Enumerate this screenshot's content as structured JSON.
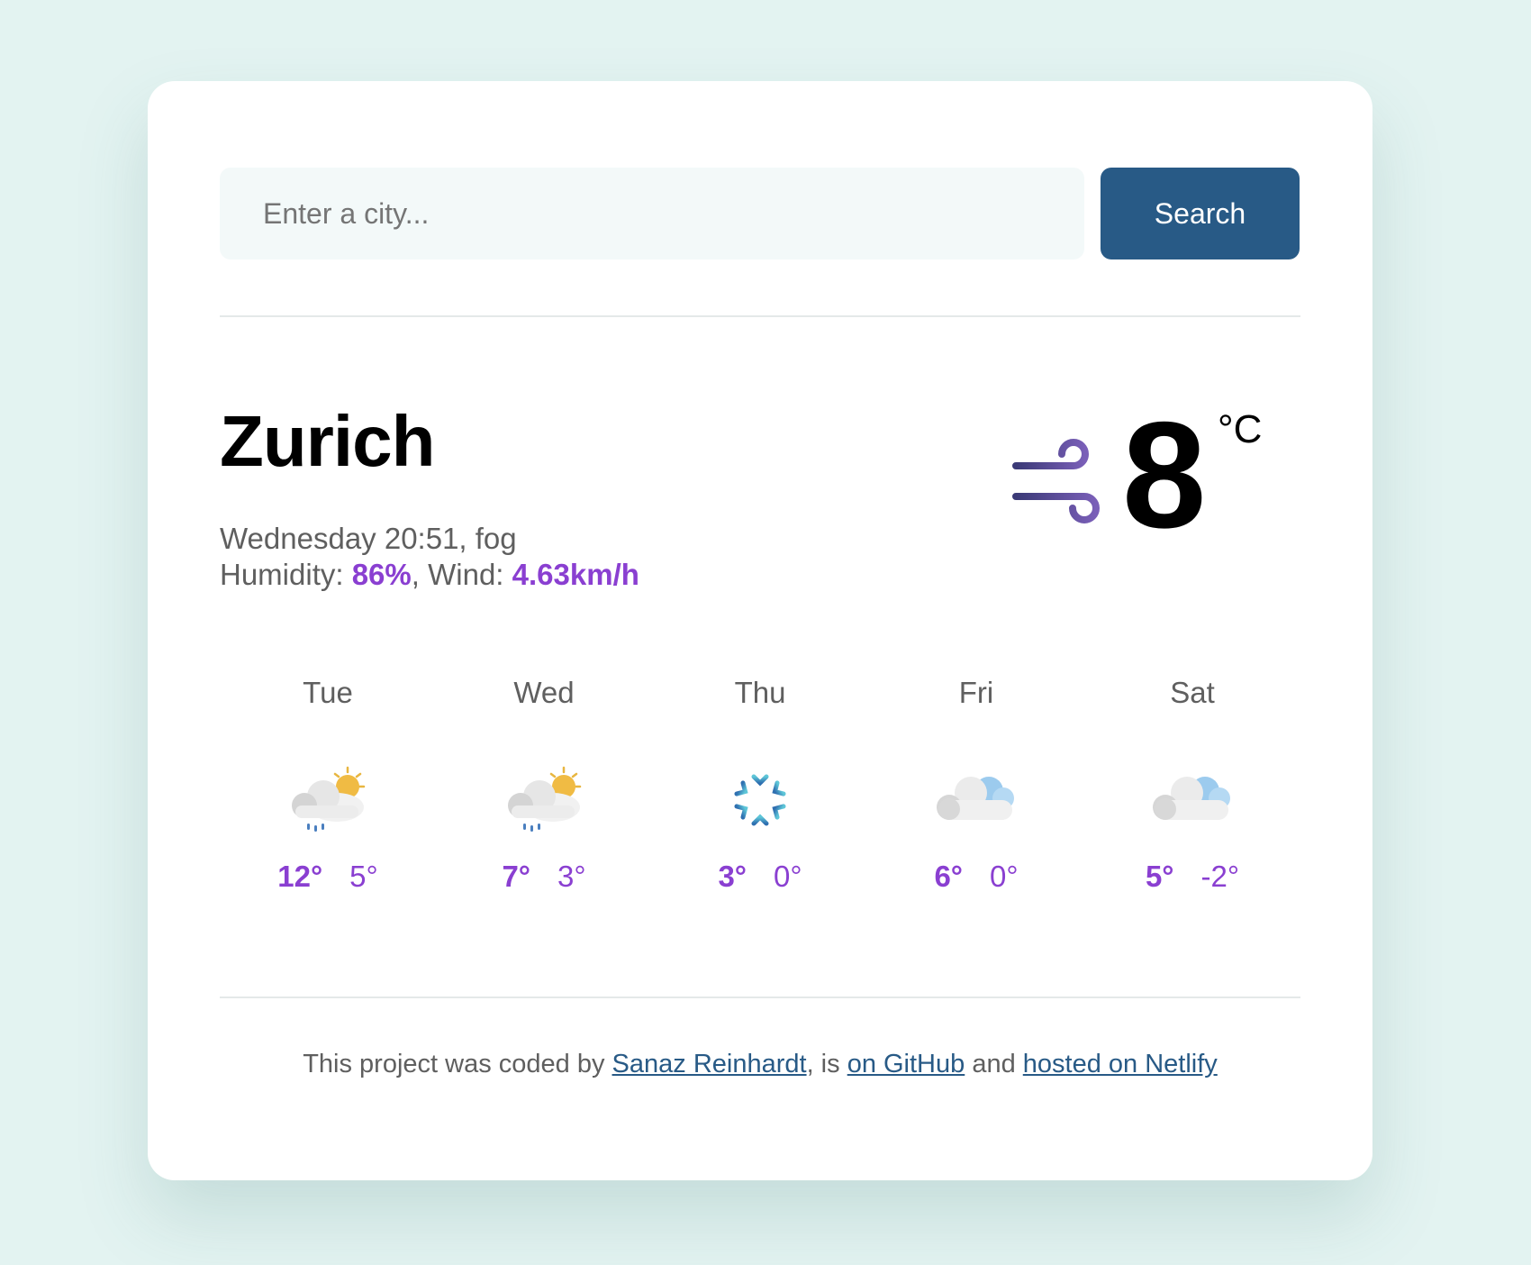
{
  "search": {
    "placeholder": "Enter a city...",
    "value": "",
    "button_label": "Search"
  },
  "current": {
    "city": "Zurich",
    "day_time": "Wednesday 20:51",
    "description": "fog",
    "humidity_label": "Humidity:",
    "humidity_value": "86%",
    "wind_label": "Wind:",
    "wind_value": "4.63km/h",
    "temperature": "8",
    "unit": "°C",
    "icon": "wind-icon"
  },
  "forecast": [
    {
      "day": "Tue",
      "icon": "rain-cloud-sun-icon",
      "max": "12°",
      "min": "5°"
    },
    {
      "day": "Wed",
      "icon": "rain-cloud-sun-icon",
      "max": "7°",
      "min": "3°"
    },
    {
      "day": "Thu",
      "icon": "snowflake-icon",
      "max": "3°",
      "min": "0°"
    },
    {
      "day": "Fri",
      "icon": "cloud-icon",
      "max": "6°",
      "min": "0°"
    },
    {
      "day": "Sat",
      "icon": "cloud-icon",
      "max": "5°",
      "min": "-2°"
    }
  ],
  "footer": {
    "text_1": "This project was coded by ",
    "author_link": "Sanaz Reinhardt",
    "text_2": ", is ",
    "github_link": "on GitHub",
    "text_3": " and ",
    "netlify_link": "hosted on Netlify"
  },
  "colors": {
    "background": "#e3f3f1",
    "accent_button": "#285a86",
    "highlight": "#8a3fd1",
    "link": "#285a86"
  }
}
